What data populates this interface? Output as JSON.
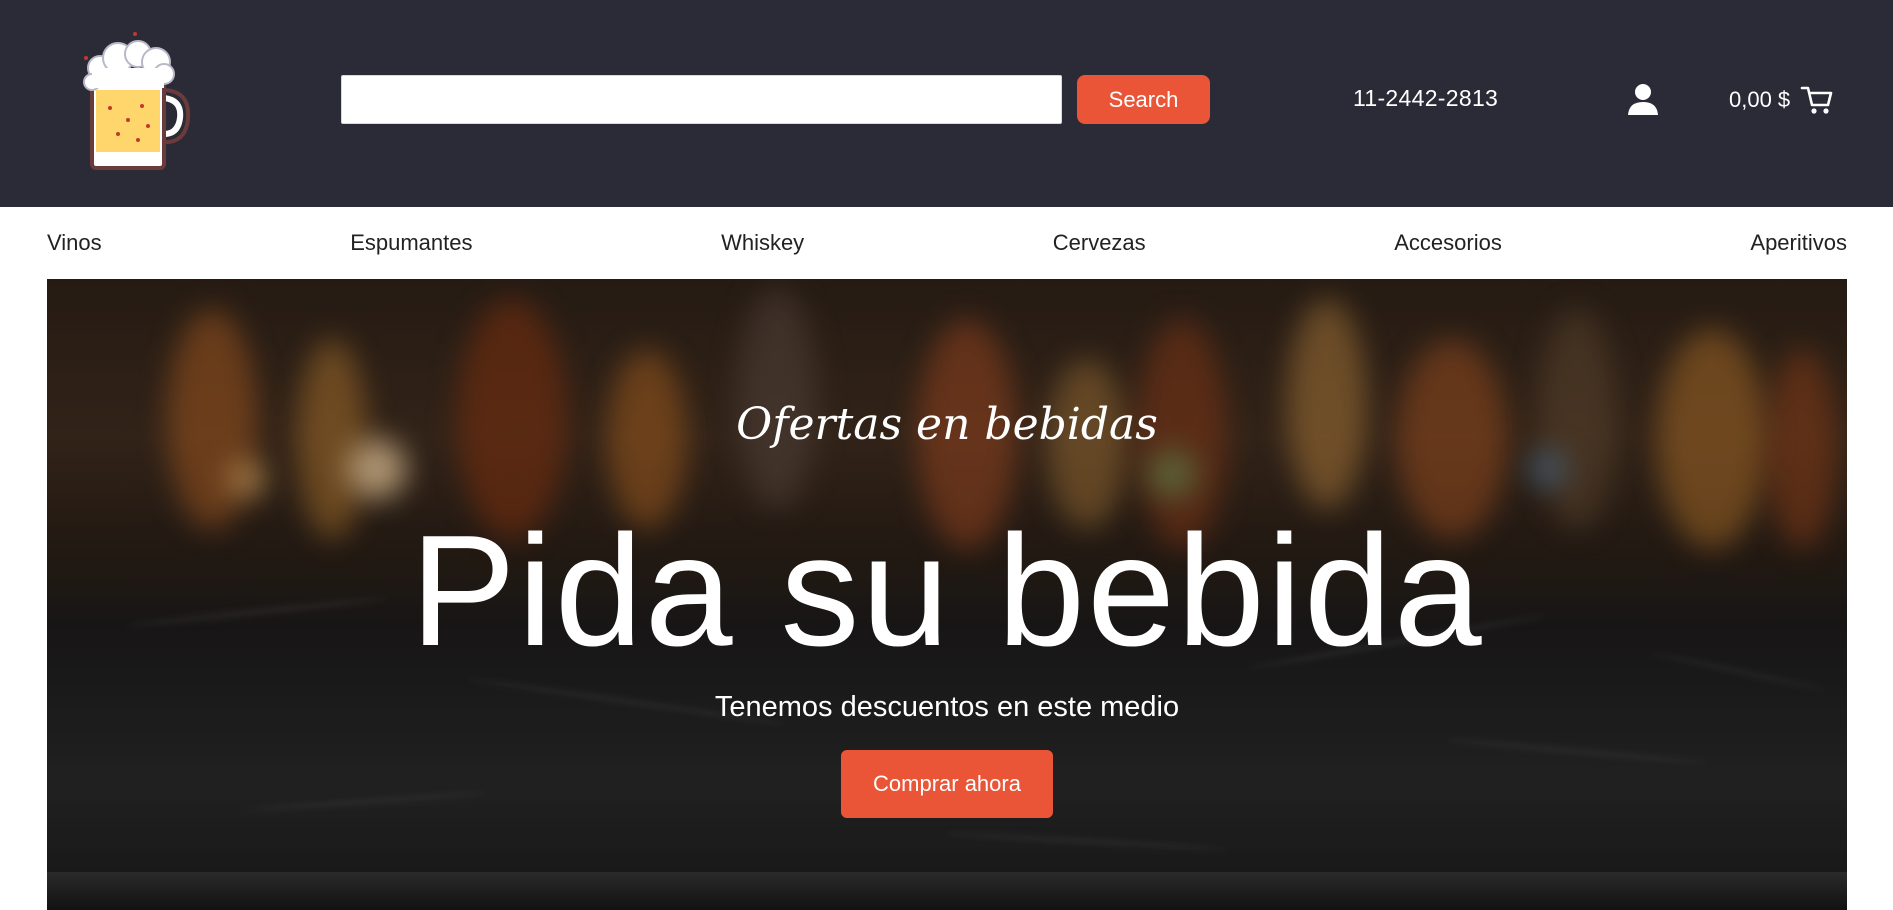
{
  "header": {
    "logo_name": "beer-mug-logo",
    "search": {
      "placeholder": "",
      "value": "",
      "button_label": "Search"
    },
    "phone": "11-2442-2813",
    "cart": {
      "amount": "0,00 $"
    }
  },
  "nav": {
    "items": [
      {
        "label": "Vinos"
      },
      {
        "label": "Espumantes"
      },
      {
        "label": "Whiskey"
      },
      {
        "label": "Cervezas"
      },
      {
        "label": "Accesorios"
      },
      {
        "label": "Aperitivos"
      }
    ]
  },
  "hero": {
    "kicker": "Ofertas en bebidas",
    "title": "Pida su bebida",
    "subtitle": "Tenemos descuentos en este medio",
    "cta_label": "Comprar ahora"
  },
  "colors": {
    "header_bg": "#2b2a37",
    "accent": "#ea5437",
    "text_light": "#ffffff",
    "text_dark": "#222222"
  },
  "icons": [
    "beer-mug-logo",
    "user-icon",
    "cart-icon"
  ]
}
